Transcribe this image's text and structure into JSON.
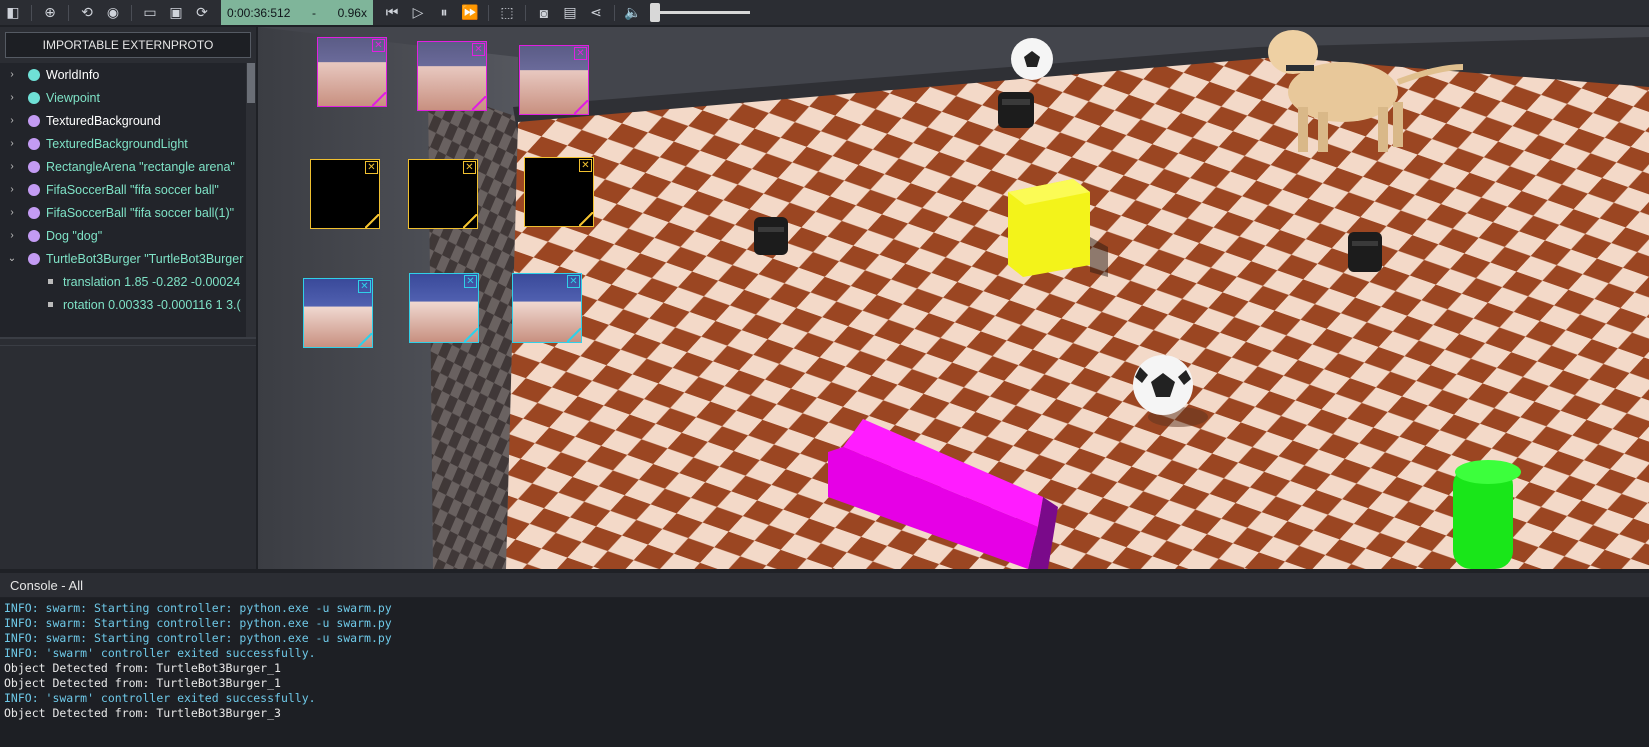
{
  "toolbar": {
    "time": "0:00:36:512",
    "time_sep": "-",
    "speed": "0.96x",
    "icons": [
      "sidebar-toggle-icon",
      "add-node-icon",
      "reset-view-icon",
      "visibility-icon",
      "open-file-icon",
      "save-icon",
      "reload-icon",
      "step-back-icon",
      "play-icon",
      "pause-icon",
      "fast-forward-icon",
      "3d-cube-icon",
      "camera-icon",
      "film-icon",
      "share-icon",
      "mute-icon"
    ],
    "glyphs": {
      "sidebar": "◧",
      "add": "⊕",
      "reset": "⟲",
      "eye": "◉",
      "open": "▭",
      "save": "▣",
      "reload": "⟳",
      "stepback": "⏮",
      "play": "▷",
      "pause": "⏸",
      "ff": "⏩",
      "cube": "⬚",
      "camera": "◙",
      "film": "▤",
      "share": "⋖",
      "mute": "🔈"
    },
    "volume_fraction": 0.0
  },
  "left_panel": {
    "extern_button": "IMPORTABLE EXTERNPROTO",
    "tree": [
      {
        "label": "WorldInfo",
        "dot": "cyan",
        "style": "plain"
      },
      {
        "label": "Viewpoint",
        "dot": "cyan",
        "style": "proto"
      },
      {
        "label": "TexturedBackground",
        "dot": "purple",
        "style": "plain"
      },
      {
        "label": "TexturedBackgroundLight",
        "dot": "purple",
        "style": "proto"
      },
      {
        "label": "RectangleArena \"rectangle arena\"",
        "dot": "purple",
        "style": "proto"
      },
      {
        "label": "FifaSoccerBall \"fifa soccer ball\"",
        "dot": "purple",
        "style": "proto"
      },
      {
        "label": "FifaSoccerBall \"fifa soccer ball(1)\"",
        "dot": "purple",
        "style": "proto"
      },
      {
        "label": "Dog \"dog\"",
        "dot": "purple",
        "style": "proto"
      },
      {
        "label": "TurtleBot3Burger \"TurtleBot3Burger",
        "dot": "purple",
        "style": "proto",
        "expanded": true
      }
    ],
    "fields": [
      {
        "label": "translation 1.85 -0.282 -0.00024"
      },
      {
        "label": "rotation 0.00333 -0.000116 1 3.("
      }
    ],
    "arrows": {
      "collapsed": "›",
      "expanded": "⌄"
    }
  },
  "view3d": {
    "close_glyph": "✕",
    "overlays": [
      {
        "color": "#e020e0",
        "scene": "lavender"
      },
      {
        "color": "#e020e0",
        "scene": "lavender"
      },
      {
        "color": "#e020e0",
        "scene": "lavender"
      },
      {
        "color": "#f0c030",
        "scene": "black"
      },
      {
        "color": "#f0c030",
        "scene": "black"
      },
      {
        "color": "#f0c030",
        "scene": "black"
      },
      {
        "color": "#30d0e8",
        "scene": "blue"
      },
      {
        "color": "#30d0e8",
        "scene": "blue"
      },
      {
        "color": "#30d0e8",
        "scene": "blue"
      }
    ]
  },
  "console": {
    "title": "Console - All",
    "lines": [
      {
        "text": "INFO: swarm: Starting controller: python.exe -u swarm.py",
        "kind": "info"
      },
      {
        "text": "INFO: swarm: Starting controller: python.exe -u swarm.py",
        "kind": "info"
      },
      {
        "text": "INFO: swarm: Starting controller: python.exe -u swarm.py",
        "kind": "info"
      },
      {
        "text": "INFO: 'swarm' controller exited successfully.",
        "kind": "info"
      },
      {
        "text": "Object Detected from: TurtleBot3Burger_1",
        "kind": "plain"
      },
      {
        "text": "Object Detected from: TurtleBot3Burger_1",
        "kind": "plain"
      },
      {
        "text": "INFO: 'swarm' controller exited successfully.",
        "kind": "info"
      },
      {
        "text": "Object Detected from: TurtleBot3Burger_3",
        "kind": "plain"
      }
    ]
  }
}
